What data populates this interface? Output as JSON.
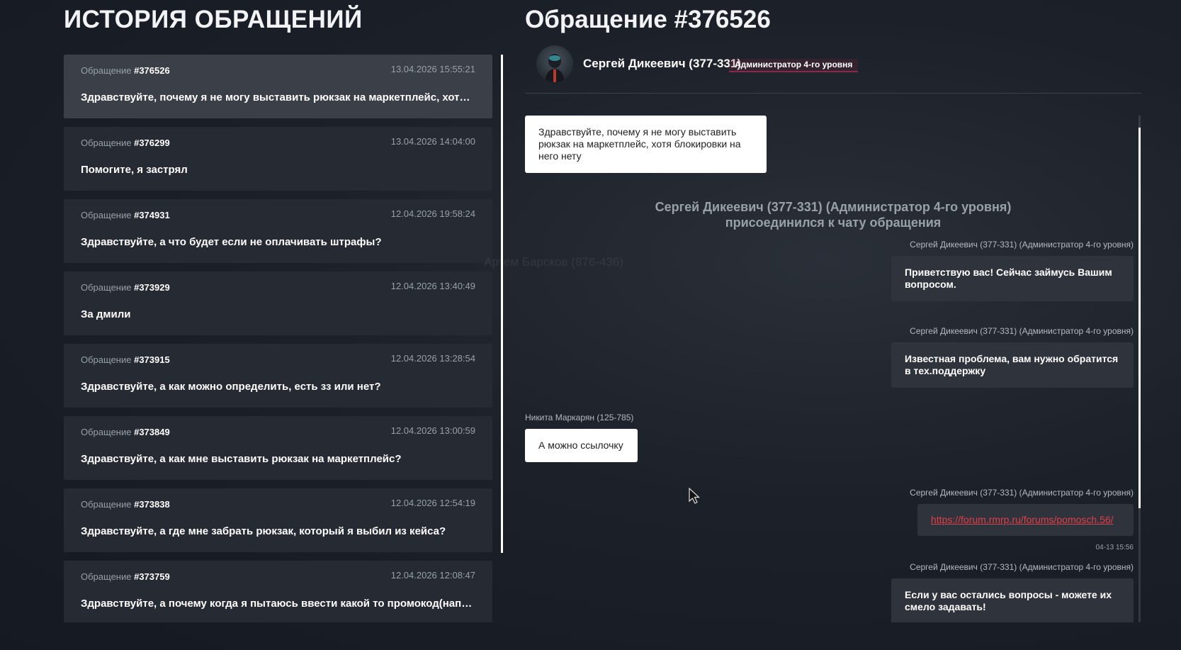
{
  "left_panel": {
    "title": "ИСТОРИЯ ОБРАЩЕНИЙ",
    "ticket_prefix": "Обращение",
    "tickets": [
      {
        "number": "#376526",
        "date": "13.04.2026 15:55:21",
        "text": "Здравствуйте, почему я не могу выставить рюкзак на маркетплейс, хотя блокировки на него нету"
      },
      {
        "number": "#376299",
        "date": "13.04.2026 14:04:00",
        "text": "Помогите, я застрял"
      },
      {
        "number": "#374931",
        "date": "12.04.2026 19:58:24",
        "text": "Здравствуйте, а что будет если не оплачивать штрафы?"
      },
      {
        "number": "#373929",
        "date": "12.04.2026 13:40:49",
        "text": "За дмили"
      },
      {
        "number": "#373915",
        "date": "12.04.2026 13:28:54",
        "text": "Здравствуйте, а как можно определить, есть зз или нет?"
      },
      {
        "number": "#373849",
        "date": "12.04.2026 13:00:59",
        "text": "Здравствуйте, а как мне выставить рюкзак на маркетплейс?"
      },
      {
        "number": "#373838",
        "date": "12.04.2026 12:54:19",
        "text": "Здравствуйте, а где мне забрать рюкзак, который я выбил из кейса?"
      },
      {
        "number": "#373759",
        "date": "12.04.2026 12:08:47",
        "text": "Здравствуйте, а почему когда я пытаюсь ввести какой то промокод(например"
      }
    ]
  },
  "right_panel": {
    "title": "Обращение #376526",
    "admin": {
      "name": "Сергей Дикеевич (377-331)",
      "role": "Администратор 4-го уровня"
    },
    "watermark": "Артем Барсков (876-436)",
    "messages": {
      "m1": {
        "text": "Здравствуйте, почему я не могу выставить рюкзак на маркетплейс, хотя блокировки на него нету"
      },
      "system": {
        "line1": "Сергей Дикеевич (377-331) (Администратор 4-го уровня)",
        "line2": "присоединился к чату обращения"
      },
      "m2": {
        "sender": "Сергей Дикеевич (377-331) (Администратор 4-го уровня)",
        "text": "Приветствую вас! Сейчас займусь Вашим вопросом."
      },
      "m3": {
        "sender": "Сергей Дикеевич (377-331) (Администратор 4-го уровня)",
        "text": "Известная проблема, вам нужно обратится в тех.поддержку"
      },
      "m4": {
        "sender": "Никита Маркарян (125-785)",
        "text": "А можно ссылочку"
      },
      "m5": {
        "sender": "Сергей Дикеевич (377-331) (Администратор 4-го уровня)",
        "link": "https://forum.rmrp.ru/forums/pomosch.56/",
        "time": "04-13 15:56"
      },
      "m6": {
        "sender": "Сергей Дикеевич (377-331) (Администратор 4-го уровня)",
        "text": "Если у вас остались вопросы - можете их смело задавать!"
      }
    }
  },
  "colors": {
    "active_ticket": "#3a3f48",
    "ticket": "#252a33",
    "link": "#e0404a",
    "role_accent": "#8a2a4a"
  }
}
